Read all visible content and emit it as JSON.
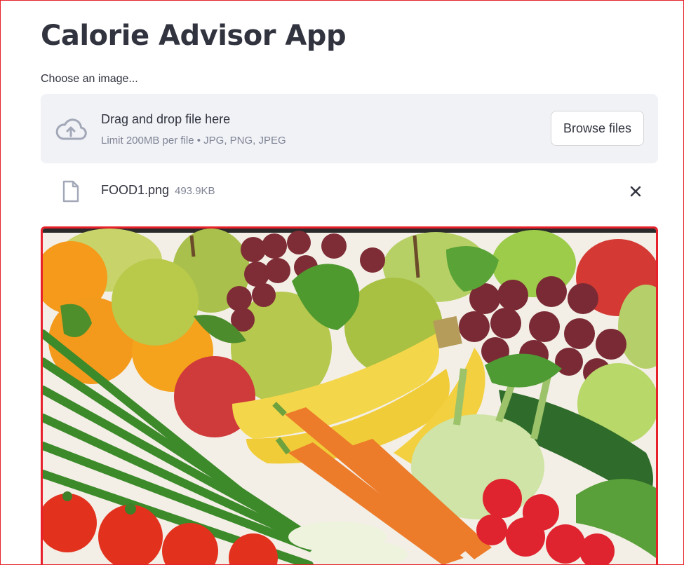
{
  "page": {
    "title": "Calorie Advisor App"
  },
  "uploader": {
    "label": "Choose an image...",
    "dropzone_title": "Drag and drop file here",
    "dropzone_subtitle": "Limit 200MB per file • JPG, PNG, JPEG",
    "browse_label": "Browse files",
    "icon": "cloud-upload-icon"
  },
  "uploaded_file": {
    "name": "FOOD1.png",
    "size": "493.9KB",
    "icon": "file-icon",
    "remove_icon": "close-icon"
  },
  "image": {
    "subject": "fruits-and-vegetables-photo"
  },
  "colors": {
    "highlight_border": "#e8202a",
    "dropzone_bg": "#f0f2f6",
    "text": "#31333f",
    "muted_text": "#808495"
  }
}
